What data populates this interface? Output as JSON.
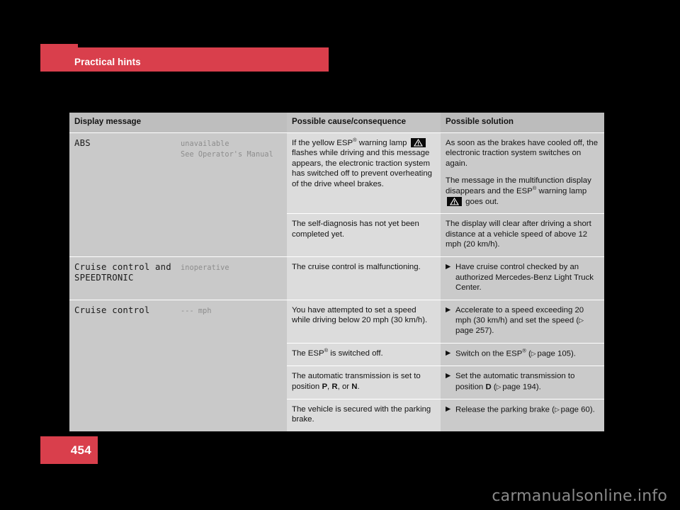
{
  "section": {
    "title": "Practical hints",
    "accent_color": "#d93f4c"
  },
  "page": {
    "number": "454"
  },
  "watermark": {
    "text": "carmanualsonline.info"
  },
  "table": {
    "headers": {
      "display_message": "Display message",
      "possible_cause": "Possible cause/consequence",
      "possible_solution": "Possible solution"
    },
    "rows": [
      {
        "message_main": "ABS",
        "message_value_line1": "unavailable",
        "message_value_line2": "See Operator's Manual",
        "subrows": [
          {
            "cause_part1": "If the yellow ESP",
            "cause_part2": " warning lamp ",
            "cause_icon": "warning-triangle-lamp-icon",
            "cause_part3": " flashes while driving and this message appears, the electronic traction system has switched off to prevent overheating of the drive wheel brakes.",
            "solution_p1": "As soon as the brakes have cooled off, the electronic traction system switches on again.",
            "solution_p2_part1": "The message in the multifunction display disappears and the ESP",
            "solution_p2_part2": " warning lamp ",
            "solution_icon": "warning-triangle-lamp-icon",
            "solution_p2_part3": " goes out."
          },
          {
            "cause_plain": "The self-diagnosis has not yet been completed yet.",
            "solution_plain": "The display will clear after driving a short distance at a vehicle speed of above 12 mph (20 km/h)."
          }
        ]
      },
      {
        "message_main_line1": "Cruise control and",
        "message_main_line2": "SPEEDTRONIC",
        "message_value_line1": "inoperative",
        "subrows": [
          {
            "cause_plain": "The cruise control is malfunctioning.",
            "solution_bullet": "Have cruise control checked by an authorized Mercedes-Benz Light Truck Center."
          }
        ]
      },
      {
        "message_main": "Cruise control",
        "message_value_line1": "--- mph",
        "subrows": [
          {
            "cause_plain": "You have attempted to set a speed while driving below 20 mph (30 km/h).",
            "solution_bullet_part1": "Accelerate to a speed exceeding 20 mph (30 km/h) and set the speed (",
            "solution_pageref": "page 257",
            "solution_bullet_part2": ")."
          },
          {
            "cause_part1": "The ESP",
            "cause_part2": " is switched off.",
            "solution_bullet_part1": "Switch on the ESP",
            "solution_bullet_part2": " (",
            "solution_pageref": "page 105",
            "solution_bullet_part3": ")."
          },
          {
            "cause_part1": "The automatic transmission is set to position ",
            "cause_bold1": "P",
            "cause_part2": ", ",
            "cause_bold2": "R",
            "cause_part3": ", or ",
            "cause_bold3": "N",
            "cause_part4": ".",
            "solution_bullet_part1": "Set the automatic transmission to position ",
            "solution_bold1": "D",
            "solution_bullet_part2": " (",
            "solution_pageref": "page 194",
            "solution_bullet_part3": ")."
          },
          {
            "cause_plain": "The vehicle is secured with the parking brake.",
            "solution_bullet_part1": "Release the parking brake (",
            "solution_pageref": "page 60",
            "solution_bullet_part2": ")."
          }
        ]
      }
    ]
  }
}
